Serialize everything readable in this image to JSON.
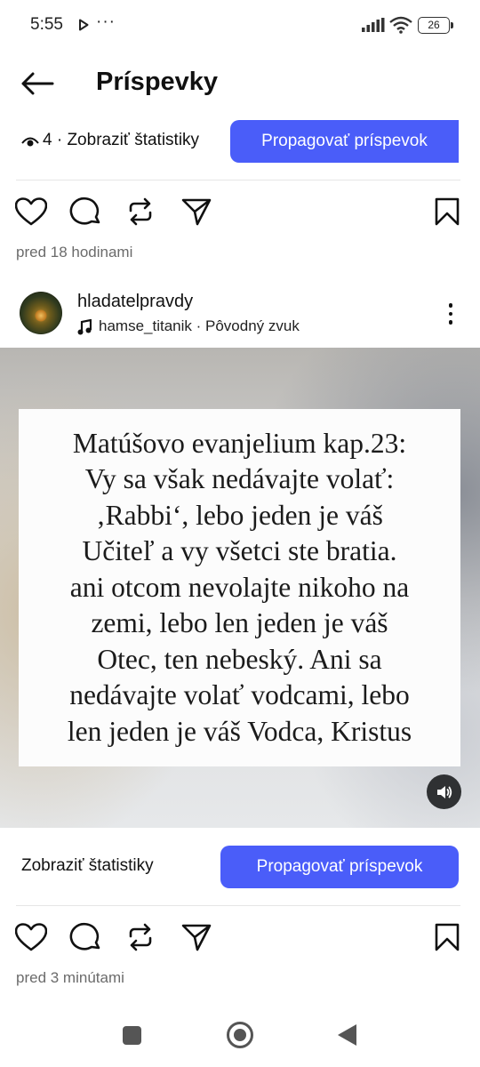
{
  "status_bar": {
    "time": "5:55",
    "more": "···",
    "battery": "26"
  },
  "header": {
    "title": "Príspevky"
  },
  "post_previous": {
    "views": "4 · Zobraziť štatistiky",
    "promote_label": "Propagovať príspevok",
    "timestamp": "pred 18 hodinami"
  },
  "post": {
    "username": "hladatelpravdy",
    "audio": "hamse_titanik · Pôvodný zvuk",
    "quote_lines": [
      "Matúšovo evanjelium kap.23:",
      "Vy sa však nedávajte volať:",
      "‚Rabbi‘, lebo jeden je váš",
      "Učiteľ a vy všetci ste bratia.",
      "ani otcom nevolajte nikoho na",
      "zemi, lebo len jeden je váš",
      "Otec, ten nebeský. Ani sa",
      "nedávajte volať vodcami, lebo",
      "len jeden je váš Vodca, Kristus"
    ],
    "stats_label": "Zobraziť štatistiky",
    "promote_label": "Propagovať príspevok",
    "timestamp": "pred 3 minútami"
  },
  "icons": {
    "back": "arrow-left-icon",
    "like": "heart-icon",
    "comment": "comment-icon",
    "repost": "repost-icon",
    "share": "send-icon",
    "save": "bookmark-icon",
    "views": "eye-icon",
    "audio": "music-note-icon",
    "sound": "speaker-icon"
  },
  "colors": {
    "accent": "#4a5df9",
    "text": "#111111",
    "muted": "#6b6b6b"
  }
}
